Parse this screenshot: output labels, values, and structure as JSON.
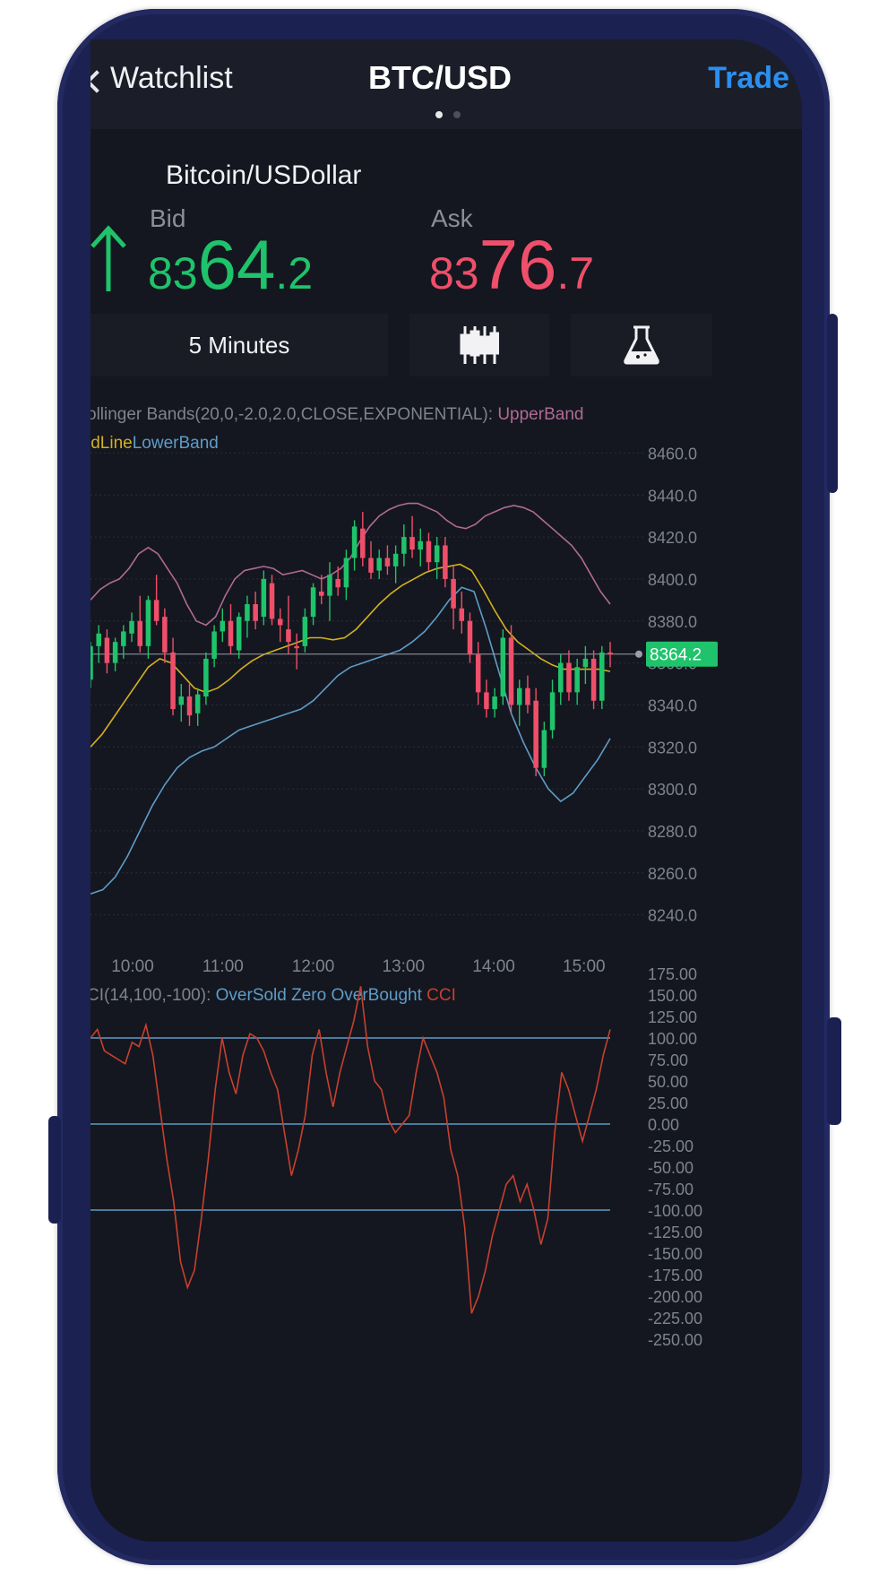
{
  "nav": {
    "back_label": "Watchlist",
    "title": "BTC/USD",
    "action_label": "Trade",
    "page_dots": 2,
    "active_dot": 0
  },
  "instrument": {
    "name": "Bitcoin/USDollar",
    "direction_icon": "arrow-up-icon",
    "bid": {
      "label": "Bid",
      "prefix": "83",
      "main": "64",
      "suffix": ".2"
    },
    "ask": {
      "label": "Ask",
      "prefix": "83",
      "main": "76",
      "suffix": ".7"
    }
  },
  "toolbar": {
    "interval_label": "5 Minutes",
    "chart_type_icon": "candlestick-icon",
    "studies_icon": "flask-icon"
  },
  "colors": {
    "up": "#1fc36b",
    "down": "#ef4f6a",
    "accent_blue": "#2b8ff1",
    "upper_band": "#b06a96",
    "mid_line": "#d4b020",
    "lower_band": "#5e9cc8",
    "cci_line": "#c8402f",
    "cci_levels": "#5e9cc8",
    "grid": "#2a2e38",
    "axis_text": "#7f838d"
  },
  "chart_data": [
    {
      "type": "candlestick",
      "indicator_title": "ollinger Bands(20,0,-2.0,2.0,CLOSE,EXPONENTIAL): ",
      "legend": [
        "UpperBand",
        "idLine",
        "LowerBand"
      ],
      "ylim": [
        8230,
        8470
      ],
      "y_ticks": [
        "8460.0",
        "8440.0",
        "8420.0",
        "8400.0",
        "8380.0",
        "8360.0",
        "8340.0",
        "8320.0",
        "8300.0",
        "8280.0",
        "8260.0",
        "8240.0"
      ],
      "x_ticks": [
        "10:00",
        "11:00",
        "12:00",
        "13:00",
        "14:00",
        "15:00"
      ],
      "x_tick_positions_min": [
        600,
        660,
        720,
        780,
        840,
        900
      ],
      "x_range_min": [
        572,
        940
      ],
      "last_price": 8364.2,
      "last_price_label": "8364.2",
      "candle_times_min": [
        572,
        577,
        582,
        587,
        592,
        597,
        602,
        607,
        612,
        617,
        622,
        627,
        632,
        637,
        642,
        647,
        652,
        657,
        662,
        667,
        672,
        677,
        682,
        687,
        692,
        697,
        702,
        707,
        712,
        717,
        722,
        727,
        732,
        737,
        742,
        747,
        752,
        757,
        762,
        767,
        772,
        777,
        782,
        787,
        792,
        797,
        802,
        807,
        812,
        817,
        822,
        827,
        832,
        837,
        842,
        847,
        852,
        857,
        862,
        867,
        872,
        877,
        882,
        887,
        892,
        897,
        902,
        907,
        912,
        917,
        922,
        927,
        932,
        937
      ],
      "ohlc": [
        [
          8352,
          8370,
          8348,
          8368
        ],
        [
          8368,
          8378,
          8360,
          8374
        ],
        [
          8372,
          8376,
          8355,
          8360
        ],
        [
          8360,
          8372,
          8356,
          8370
        ],
        [
          8368,
          8378,
          8362,
          8375
        ],
        [
          8374,
          8384,
          8370,
          8380
        ],
        [
          8380,
          8392,
          8365,
          8368
        ],
        [
          8368,
          8392,
          8362,
          8390
        ],
        [
          8390,
          8402,
          8378,
          8380
        ],
        [
          8382,
          8386,
          8360,
          8365
        ],
        [
          8365,
          8372,
          8335,
          8338
        ],
        [
          8340,
          8350,
          8332,
          8344
        ],
        [
          8344,
          8350,
          8330,
          8335
        ],
        [
          8336,
          8348,
          8330,
          8345
        ],
        [
          8344,
          8365,
          8340,
          8362
        ],
        [
          8362,
          8378,
          8358,
          8375
        ],
        [
          8375,
          8386,
          8370,
          8380
        ],
        [
          8380,
          8388,
          8364,
          8368
        ],
        [
          8366,
          8384,
          8362,
          8382
        ],
        [
          8380,
          8392,
          8372,
          8388
        ],
        [
          8388,
          8394,
          8376,
          8380
        ],
        [
          8382,
          8404,
          8378,
          8400
        ],
        [
          8398,
          8402,
          8378,
          8381
        ],
        [
          8381,
          8386,
          8370,
          8378
        ],
        [
          8376,
          8392,
          8364,
          8370
        ],
        [
          8368,
          8374,
          8357,
          8367
        ],
        [
          8368,
          8386,
          8365,
          8382
        ],
        [
          8382,
          8398,
          8378,
          8396
        ],
        [
          8394,
          8402,
          8388,
          8392
        ],
        [
          8392,
          8408,
          8380,
          8402
        ],
        [
          8400,
          8406,
          8392,
          8396
        ],
        [
          8396,
          8414,
          8390,
          8410
        ],
        [
          8410,
          8428,
          8404,
          8425
        ],
        [
          8424,
          8432,
          8406,
          8410
        ],
        [
          8410,
          8418,
          8400,
          8403
        ],
        [
          8404,
          8414,
          8400,
          8410
        ],
        [
          8410,
          8416,
          8402,
          8406
        ],
        [
          8406,
          8416,
          8398,
          8412
        ],
        [
          8412,
          8426,
          8406,
          8420
        ],
        [
          8420,
          8430,
          8410,
          8414
        ],
        [
          8414,
          8424,
          8406,
          8418
        ],
        [
          8418,
          8422,
          8404,
          8408
        ],
        [
          8408,
          8420,
          8400,
          8416
        ],
        [
          8416,
          8420,
          8396,
          8400
        ],
        [
          8400,
          8406,
          8376,
          8386
        ],
        [
          8386,
          8394,
          8374,
          8380
        ],
        [
          8380,
          8384,
          8360,
          8364
        ],
        [
          8364,
          8370,
          8340,
          8346
        ],
        [
          8346,
          8352,
          8334,
          8338
        ],
        [
          8338,
          8348,
          8334,
          8344
        ],
        [
          8344,
          8376,
          8340,
          8372
        ],
        [
          8372,
          8378,
          8336,
          8340
        ],
        [
          8340,
          8352,
          8330,
          8348
        ],
        [
          8348,
          8354,
          8336,
          8340
        ],
        [
          8342,
          8348,
          8306,
          8310
        ],
        [
          8310,
          8332,
          8306,
          8328
        ],
        [
          8328,
          8352,
          8324,
          8346
        ],
        [
          8346,
          8364,
          8340,
          8360
        ],
        [
          8360,
          8366,
          8342,
          8346
        ],
        [
          8346,
          8362,
          8340,
          8358
        ],
        [
          8358,
          8368,
          8350,
          8362
        ],
        [
          8362,
          8366,
          8338,
          8342
        ],
        [
          8342,
          8368,
          8338,
          8365
        ],
        [
          8365,
          8370,
          8358,
          8364
        ]
      ],
      "upper_band": [
        8390,
        8395,
        8398,
        8400,
        8405,
        8412,
        8415,
        8412,
        8405,
        8398,
        8388,
        8380,
        8378,
        8382,
        8392,
        8400,
        8404,
        8405,
        8406,
        8405,
        8402,
        8403,
        8404,
        8402,
        8400,
        8402,
        8405,
        8410,
        8418,
        8425,
        8430,
        8433,
        8435,
        8436,
        8436,
        8434,
        8432,
        8428,
        8425,
        8424,
        8426,
        8430,
        8432,
        8434,
        8435,
        8434,
        8432,
        8428,
        8424,
        8420,
        8416,
        8410,
        8402,
        8394,
        8388
      ],
      "mid_line": [
        8320,
        8326,
        8334,
        8342,
        8350,
        8358,
        8362,
        8360,
        8354,
        8348,
        8346,
        8348,
        8352,
        8357,
        8361,
        8364,
        8366,
        8368,
        8370,
        8372,
        8372,
        8371,
        8372,
        8376,
        8382,
        8388,
        8393,
        8397,
        8400,
        8403,
        8405,
        8406,
        8407,
        8404,
        8395,
        8385,
        8376,
        8370,
        8366,
        8362,
        8359,
        8357,
        8357,
        8357,
        8357,
        8356
      ],
      "lower_band": [
        8250,
        8252,
        8258,
        8268,
        8280,
        8292,
        8302,
        8310,
        8315,
        8318,
        8320,
        8324,
        8328,
        8330,
        8332,
        8334,
        8336,
        8338,
        8342,
        8348,
        8354,
        8358,
        8360,
        8362,
        8364,
        8366,
        8370,
        8375,
        8382,
        8390,
        8396,
        8394,
        8376,
        8356,
        8336,
        8322,
        8310,
        8300,
        8294,
        8298,
        8306,
        8314,
        8324
      ]
    },
    {
      "type": "line",
      "indicator_title": "CI(14,100,-100): ",
      "legend": [
        "OverSold",
        "Zero",
        "OverBought",
        "CCI"
      ],
      "ylim": [
        -262.5,
        187.5
      ],
      "y_ticks": [
        "175.00",
        "150.00",
        "125.00",
        "100.00",
        "75.00",
        "50.00",
        "25.00",
        "0.00",
        "-25.00",
        "-50.00",
        "-75.00",
        "-100.00",
        "-125.00",
        "-150.00",
        "-175.00",
        "-200.00",
        "-225.00",
        "-250.00"
      ],
      "levels": [
        100,
        0,
        -100
      ],
      "cci": [
        100,
        110,
        85,
        80,
        75,
        70,
        95,
        90,
        115,
        80,
        20,
        -40,
        -90,
        -160,
        -190,
        -170,
        -110,
        -40,
        40,
        100,
        60,
        35,
        80,
        105,
        100,
        85,
        60,
        40,
        -10,
        -60,
        -30,
        10,
        80,
        110,
        60,
        20,
        60,
        90,
        120,
        160,
        90,
        50,
        40,
        5,
        -10,
        0,
        10,
        60,
        100,
        80,
        60,
        30,
        -30,
        -60,
        -120,
        -220,
        -200,
        -170,
        -130,
        -100,
        -70,
        -60,
        -90,
        -70,
        -100,
        -140,
        -110,
        -10,
        60,
        40,
        10,
        -20,
        10,
        40,
        80,
        110
      ]
    }
  ]
}
